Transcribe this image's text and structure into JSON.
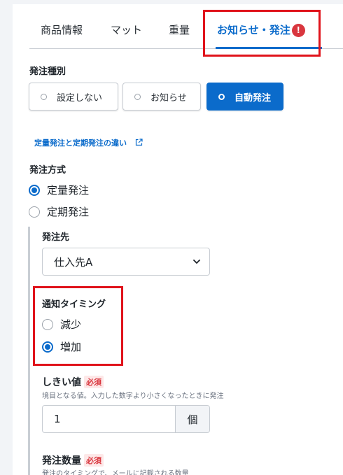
{
  "tabs": [
    {
      "label": "商品情報"
    },
    {
      "label": "マット"
    },
    {
      "label": "重量"
    },
    {
      "label": "お知らせ・発注",
      "error_badge": "!"
    }
  ],
  "order_type": {
    "label": "発注種別",
    "options": [
      {
        "label": "設定しない",
        "selected": false
      },
      {
        "label": "お知らせ",
        "selected": false
      },
      {
        "label": "自動発注",
        "selected": true
      }
    ]
  },
  "help_link": {
    "label": "定量発注と定期発注の違い",
    "icon": "external-link-icon"
  },
  "order_method": {
    "label": "発注方式",
    "options": [
      {
        "label": "定量発注",
        "checked": true
      },
      {
        "label": "定期発注",
        "checked": false
      }
    ]
  },
  "supplier": {
    "label": "発注先",
    "value": "仕入先A"
  },
  "notify_timing": {
    "label": "通知タイミング",
    "options": [
      {
        "label": "減少",
        "checked": false
      },
      {
        "label": "増加",
        "checked": true
      }
    ]
  },
  "threshold": {
    "label": "しきい値",
    "required": "必須",
    "hint": "境目となる値。入力した数字より小さくなったときに発注",
    "value": "1",
    "unit": "個"
  },
  "order_qty": {
    "label": "発注数量",
    "required": "必須",
    "hint": "発注のタイミングで、メールに記載される数量"
  },
  "colors": {
    "accent": "#0b6bcb",
    "error": "#d9363e",
    "highlight": "#e0131b"
  }
}
